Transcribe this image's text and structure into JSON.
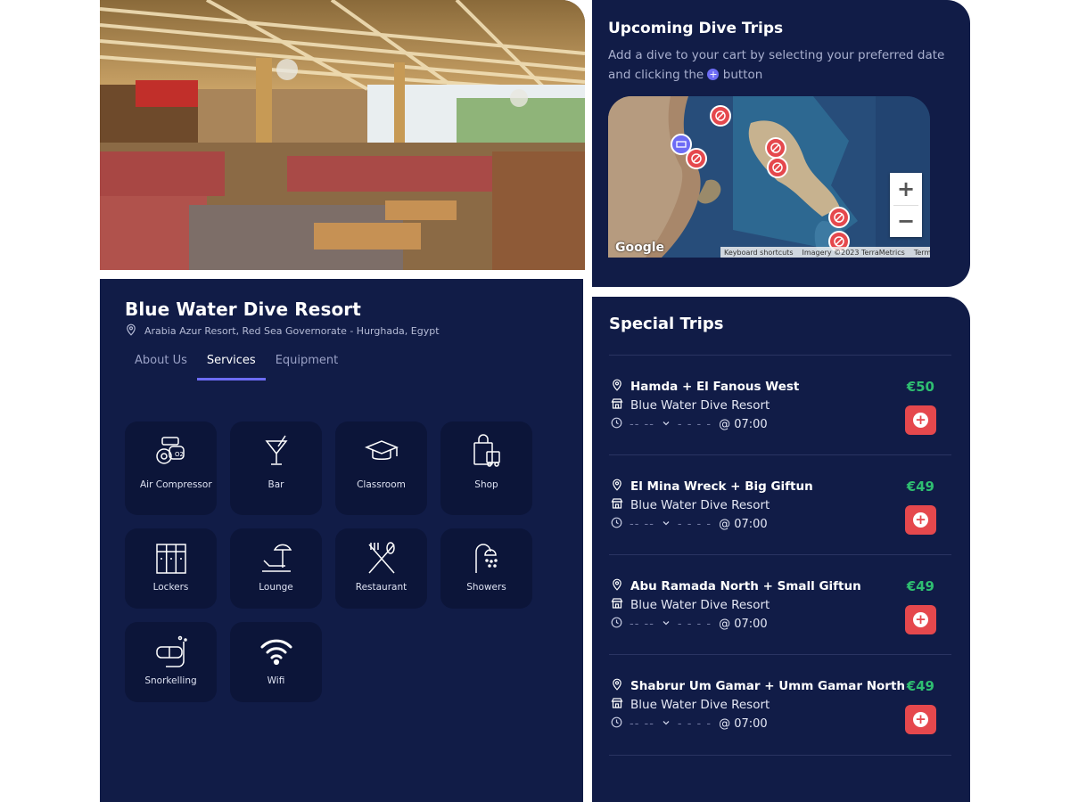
{
  "resort": {
    "name": "Blue Water Dive Resort",
    "address": "Arabia Azur Resort, Red Sea Governorate - Hurghada, Egypt",
    "tabs": [
      {
        "label": "About Us",
        "active": false
      },
      {
        "label": "Services",
        "active": true
      },
      {
        "label": "Equipment",
        "active": false
      }
    ],
    "services": [
      {
        "label": "Air Compressor",
        "icon": "air-compressor-icon"
      },
      {
        "label": "Bar",
        "icon": "cocktail-icon"
      },
      {
        "label": "Classroom",
        "icon": "graduation-cap-icon"
      },
      {
        "label": "Shop",
        "icon": "shopping-bag-icon"
      },
      {
        "label": "Lockers",
        "icon": "lockers-icon"
      },
      {
        "label": "Lounge",
        "icon": "beach-lounger-icon"
      },
      {
        "label": "Restaurant",
        "icon": "fork-knife-icon"
      },
      {
        "label": "Showers",
        "icon": "shower-icon"
      },
      {
        "label": "Snorkelling",
        "icon": "snorkel-mask-icon"
      },
      {
        "label": "Wifi",
        "icon": "wifi-icon"
      }
    ]
  },
  "upcoming": {
    "title": "Upcoming Dive Trips",
    "desc_before": "Add a dive to your cart by selecting your preferred date and clicking the",
    "plus_symbol": "+",
    "desc_after": "button"
  },
  "map": {
    "google_logo": "Google",
    "keyboard_shortcuts": "Keyboard shortcuts",
    "imagery": "Imagery ©2023 TerraMetrics",
    "terms": "Terms",
    "zoom_in": "+",
    "zoom_out": "−"
  },
  "special": {
    "title": "Special Trips",
    "trips": [
      {
        "name": "Hamda + El Fanous West",
        "center": "Blue Water Dive Resort",
        "date_placeholder": "-- --",
        "time_placeholder": "- - - -",
        "time": "@ 07:00",
        "price": "€50"
      },
      {
        "name": "El Mina Wreck + Big Giftun",
        "center": "Blue Water Dive Resort",
        "date_placeholder": "-- --",
        "time_placeholder": "- - - -",
        "time": "@ 07:00",
        "price": "€49"
      },
      {
        "name": "Abu Ramada North + Small Giftun",
        "center": "Blue Water Dive Resort",
        "date_placeholder": "-- --",
        "time_placeholder": "- - - -",
        "time": "@ 07:00",
        "price": "€49"
      },
      {
        "name": "Shabrur Um Gamar + Umm Gamar North",
        "center": "Blue Water Dive Resort",
        "date_placeholder": "-- --",
        "time_placeholder": "- - - -",
        "time": "@ 07:00",
        "price": "€49"
      }
    ]
  },
  "colors": {
    "panel_bg": "#111c47",
    "service_tile_bg": "#0c1539",
    "accent_purple": "#6d6cf5",
    "price_green": "#2fbf71",
    "add_red": "#e5484d",
    "muted_text": "#a9b0cf"
  }
}
